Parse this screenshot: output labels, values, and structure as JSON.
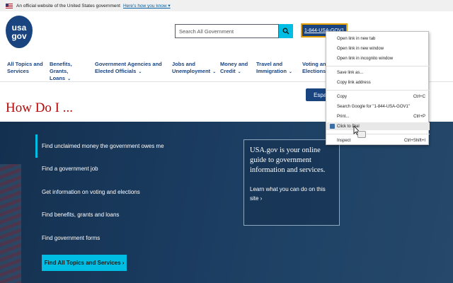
{
  "banner": {
    "text": "An official website of the United States government",
    "link": "Here's how you know",
    "chevron": "▾"
  },
  "header": {
    "logo_line1": "usa",
    "logo_line2": "gov",
    "search_placeholder": "Search All Government",
    "phone": "1-844-USA-GOV1"
  },
  "nav": {
    "items": [
      {
        "label": "All Topics and Services"
      },
      {
        "label": "Benefits, Grants, Loans"
      },
      {
        "label": "Government Agencies and Elected Officials"
      },
      {
        "label": "Jobs and Unemployment"
      },
      {
        "label": "Money and Credit"
      },
      {
        "label": "Travel and Immigration"
      },
      {
        "label": "Voting and Elections"
      }
    ]
  },
  "main": {
    "title": "How Do I ...",
    "espanol": "Español"
  },
  "hero": {
    "tasks": [
      "Find unclaimed money the government owes me",
      "Find a government job",
      "Get information on voting and elections",
      "Find benefits, grants and loans",
      "Find government forms"
    ],
    "cta": "Find All Topics and Services ›",
    "info_big": "USA.gov is your online guide to government information and services.",
    "info_small": "Learn what you can do on this site ›"
  },
  "context_menu": {
    "items": [
      {
        "label": "Open link in new tab",
        "shortcut": ""
      },
      {
        "label": "Open link in new window",
        "shortcut": ""
      },
      {
        "label": "Open link in incognito window",
        "shortcut": ""
      },
      {
        "label": "Save link as...",
        "shortcut": ""
      },
      {
        "label": "Copy link address",
        "shortcut": ""
      },
      {
        "label": "Copy",
        "shortcut": "Ctrl+C"
      },
      {
        "label": "Search Google for \"1-844-USA-GOV1\"",
        "shortcut": ""
      },
      {
        "label": "Print...",
        "shortcut": "Ctrl+P"
      },
      {
        "label": "Click to Dial",
        "shortcut": ""
      },
      {
        "label": "Inspect",
        "shortcut": "Ctrl+Shift+I"
      }
    ]
  },
  "colors": {
    "brand_blue": "#1a4480",
    "accent_cyan": "#00bde3",
    "title_red": "#b50909"
  }
}
